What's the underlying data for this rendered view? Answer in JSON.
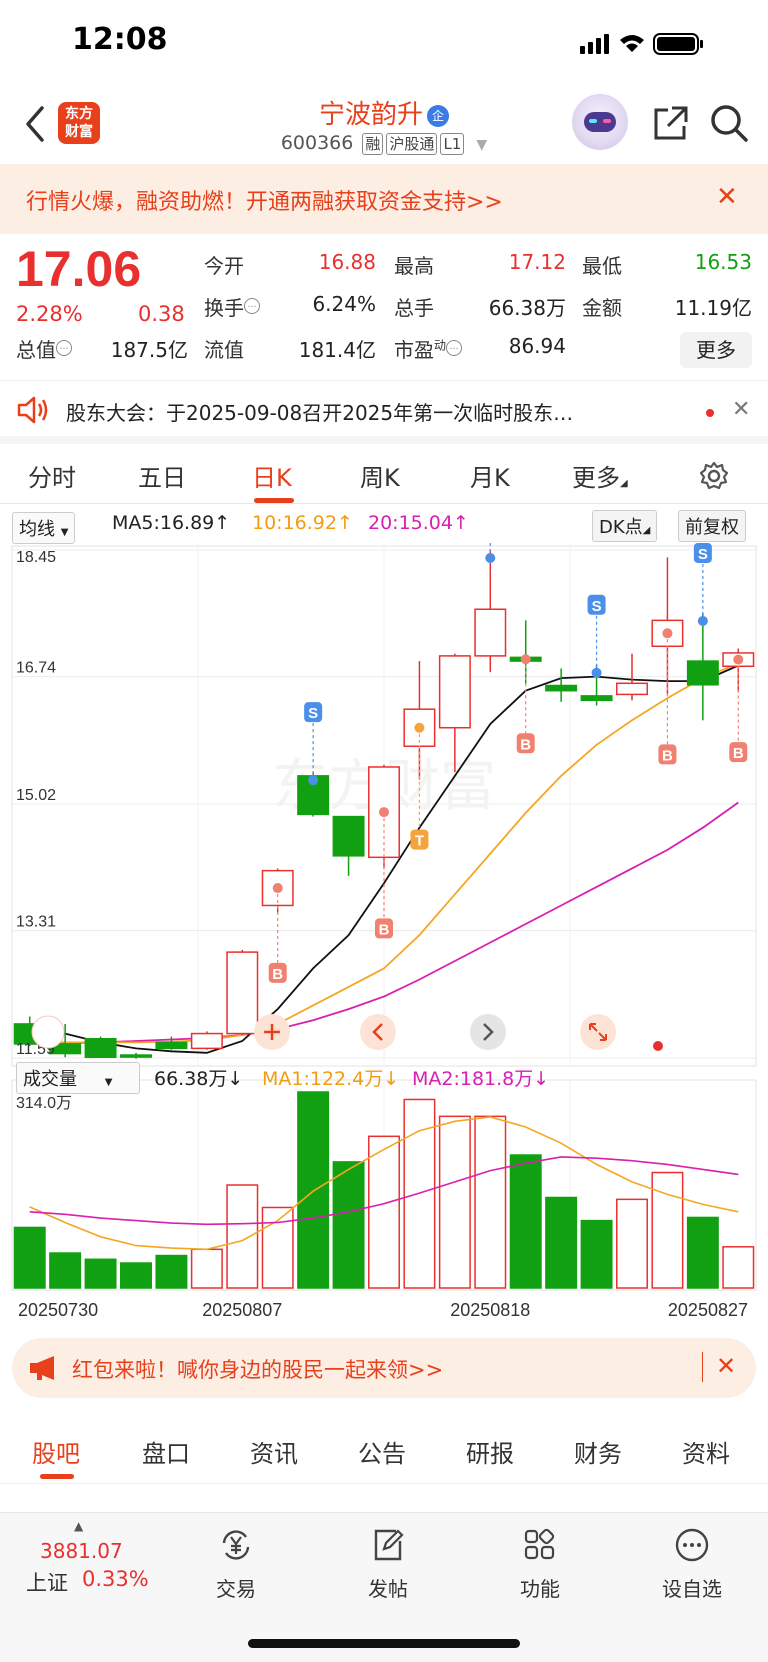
{
  "status_bar": {
    "time": "12:08"
  },
  "header": {
    "logo_line1": "东方",
    "logo_line2": "财富",
    "stock_name": "宁波韵升",
    "stock_badge": "企",
    "stock_code": "600366",
    "tags": [
      "融",
      "沪股通",
      "L1"
    ]
  },
  "promo": {
    "text": "行情火爆，融资助燃！开通两融获取资金支持>>",
    "close": "✕"
  },
  "quote": {
    "price": "17.06",
    "change_pct": "2.28%",
    "change_amt": "0.38",
    "fields": [
      {
        "label": "今开",
        "value": "16.88",
        "color": "#e8312f"
      },
      {
        "label": "最高",
        "value": "17.12",
        "color": "#e8312f"
      },
      {
        "label": "最低",
        "value": "16.53",
        "color": "#11a011"
      },
      {
        "label": "换手",
        "value": "6.24%",
        "color": "#222"
      },
      {
        "label": "总手",
        "value": "66.38万",
        "color": "#222"
      },
      {
        "label": "金额",
        "value": "11.19亿",
        "color": "#222"
      },
      {
        "label": "总值",
        "value": "187.5亿",
        "color": "#222"
      },
      {
        "label": "流值",
        "value": "181.4亿",
        "color": "#222"
      },
      {
        "label": "市盈",
        "value": "86.94",
        "color": "#222"
      }
    ],
    "pe_super": "动",
    "more_button": "更多"
  },
  "notice": {
    "text": "股东大会：于2025-09-08召开2025年第一次临时股东…",
    "close": "✕"
  },
  "chart_tabs": [
    "分时",
    "五日",
    "日K",
    "周K",
    "月K",
    "更多"
  ],
  "active_chart_tab": "日K",
  "ma_bar": {
    "selector": "均线",
    "ma5": "MA5:16.89",
    "ma10": "10:16.92",
    "ma20": "20:15.04",
    "dk_button": "DK点",
    "adjust_button": "前复权"
  },
  "volume_bar": {
    "selector": "成交量",
    "vol": "66.38万",
    "ma1": "MA1:122.4万",
    "ma2": "MA2:181.8万"
  },
  "chart_data": {
    "type": "candlestick",
    "y_ticks": [
      "18.45",
      "16.74",
      "15.02",
      "13.31",
      "11.59"
    ],
    "ylim": [
      11.59,
      18.45
    ],
    "vol_max_label": "314.0万",
    "vol_max": 314.0,
    "x_labels": [
      "20250730",
      "20250807",
      "20250818",
      "20250827"
    ],
    "candles": [
      {
        "o": 12.05,
        "h": 12.15,
        "l": 11.75,
        "c": 11.78
      },
      {
        "o": 11.78,
        "h": 12.05,
        "l": 11.6,
        "c": 11.65
      },
      {
        "o": 11.85,
        "h": 11.88,
        "l": 11.59,
        "c": 11.6
      },
      {
        "o": 11.63,
        "h": 11.66,
        "l": 11.58,
        "c": 11.62
      },
      {
        "o": 11.8,
        "h": 11.88,
        "l": 11.7,
        "c": 11.72
      },
      {
        "o": 11.72,
        "h": 11.95,
        "l": 11.7,
        "c": 11.92
      },
      {
        "o": 11.92,
        "h": 13.05,
        "l": 11.9,
        "c": 13.02
      },
      {
        "o": 13.65,
        "h": 14.15,
        "l": 13.55,
        "c": 14.12
      },
      {
        "o": 15.4,
        "h": 15.45,
        "l": 14.85,
        "c": 14.88
      },
      {
        "o": 14.85,
        "h": 14.85,
        "l": 14.05,
        "c": 14.32
      },
      {
        "o": 14.3,
        "h": 15.55,
        "l": 14.15,
        "c": 15.52
      },
      {
        "o": 15.8,
        "h": 16.95,
        "l": 15.35,
        "c": 16.3
      },
      {
        "o": 16.05,
        "h": 17.05,
        "l": 15.45,
        "c": 17.02
      },
      {
        "o": 17.02,
        "h": 18.45,
        "l": 16.8,
        "c": 17.65
      },
      {
        "o": 17.0,
        "h": 17.5,
        "l": 16.65,
        "c": 16.95
      },
      {
        "o": 16.62,
        "h": 16.85,
        "l": 16.4,
        "c": 16.55
      },
      {
        "o": 16.48,
        "h": 16.9,
        "l": 16.35,
        "c": 16.42
      },
      {
        "o": 16.5,
        "h": 17.05,
        "l": 16.42,
        "c": 16.65
      },
      {
        "o": 17.15,
        "h": 18.35,
        "l": 16.5,
        "c": 17.5
      },
      {
        "o": 16.95,
        "h": 17.6,
        "l": 16.15,
        "c": 16.63
      },
      {
        "o": 16.88,
        "h": 17.12,
        "l": 16.53,
        "c": 17.06
      }
    ],
    "ma5": [
      12.05,
      11.92,
      11.8,
      11.72,
      11.68,
      11.66,
      11.82,
      12.25,
      12.8,
      13.25,
      13.95,
      14.7,
      15.4,
      16.1,
      16.55,
      16.72,
      16.74,
      16.7,
      16.68,
      16.68,
      16.89
    ],
    "ma10": [
      11.82,
      11.8,
      11.8,
      11.8,
      11.81,
      11.83,
      11.9,
      12.05,
      12.3,
      12.55,
      12.8,
      13.25,
      13.8,
      14.35,
      14.9,
      15.4,
      15.82,
      16.15,
      16.45,
      16.72,
      16.92
    ],
    "ma20": [
      11.78,
      11.79,
      11.8,
      11.82,
      11.84,
      11.86,
      11.9,
      11.98,
      12.1,
      12.25,
      12.42,
      12.65,
      12.9,
      13.15,
      13.4,
      13.65,
      13.9,
      14.15,
      14.4,
      14.7,
      15.04
    ],
    "volumes": [
      97,
      56,
      46,
      40,
      52,
      62,
      165,
      129,
      314,
      202,
      243,
      302,
      275,
      275,
      213,
      145,
      108,
      142,
      185,
      113,
      66
    ],
    "vol_ma1": [
      130,
      105,
      82,
      68,
      64,
      62,
      76,
      108,
      155,
      190,
      222,
      252,
      267,
      274,
      258,
      232,
      198,
      170,
      150,
      134,
      122
    ],
    "vol_ma2": [
      122,
      118,
      112,
      108,
      104,
      102,
      103,
      105,
      112,
      122,
      135,
      152,
      170,
      188,
      200,
      210,
      208,
      204,
      198,
      190,
      182
    ],
    "signals": [
      {
        "i": 7,
        "kind": "B",
        "color": "#f08070"
      },
      {
        "i": 8,
        "kind": "S",
        "color": "#4a8fe8"
      },
      {
        "i": 10,
        "kind": "B",
        "color": "#f08070"
      },
      {
        "i": 11,
        "kind": "T",
        "color": "#f5a33a"
      },
      {
        "i": 13,
        "kind": "S",
        "color": "#4a8fe8"
      },
      {
        "i": 14,
        "kind": "B",
        "color": "#f08070"
      },
      {
        "i": 16,
        "kind": "S",
        "color": "#4a8fe8"
      },
      {
        "i": 18,
        "kind": "B",
        "color": "#f08070"
      },
      {
        "i": 19,
        "kind": "S",
        "color": "#4a8fe8"
      },
      {
        "i": 20,
        "kind": "B",
        "color": "#f08070"
      }
    ]
  },
  "redpack": {
    "text": "红包来啦！喊你身边的股民一起来领>>",
    "close": "✕"
  },
  "sub_tabs": [
    "股吧",
    "盘口",
    "资讯",
    "公告",
    "研报",
    "财务",
    "资料"
  ],
  "active_sub_tab": "股吧",
  "bottom_nav": {
    "index_value": "3881.07",
    "index_name": "上证",
    "index_pct": "0.33%",
    "items": [
      "交易",
      "发帖",
      "功能",
      "设自选"
    ]
  },
  "colors": {
    "up": "#e8312f",
    "down": "#11a011",
    "accent": "#e8401a",
    "ma10": "#f5a623",
    "ma20": "#d81fb0"
  }
}
